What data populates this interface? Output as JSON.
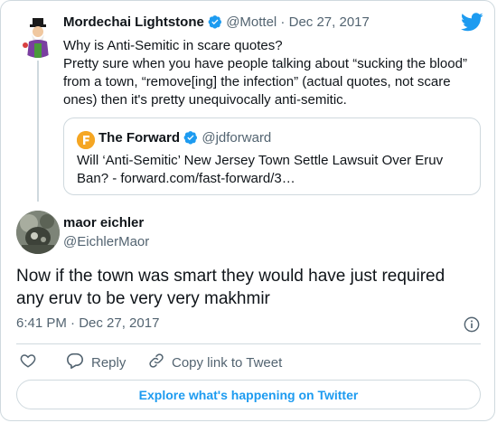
{
  "parent_tweet": {
    "author_name": "Mordechai Lightstone",
    "handle": "@Mottel",
    "date_sep": " · ",
    "date": "Dec 27, 2017",
    "text_lines": [
      "Why is Anti-Semitic in scare quotes?",
      "Pretty sure when you have people talking about “sucking the blood”",
      "from a town, “remove[ing] the infection” (actual quotes, not scare",
      "ones) then it's pretty unequivocally anti-semitic."
    ]
  },
  "quoted_tweet": {
    "author_name": "The Forward",
    "handle": "@jdforward",
    "text_lines": [
      "Will ‘Anti-Semitic’ New Jersey Town Settle Lawsuit Over Eruv",
      "Ban? - forward.com/fast-forward/3…"
    ]
  },
  "main_tweet": {
    "author_name": "maor eichler",
    "handle": "@EichlerMaor",
    "text_lines": [
      "Now if the town was smart they would have just required",
      "any eruv to be very very makhmir"
    ],
    "timestamp": "6:41 PM · Dec 27, 2017"
  },
  "actions": {
    "reply_label": "Reply",
    "copy_label": "Copy link to Tweet"
  },
  "explore_label": "Explore what's happening on Twitter",
  "icons": {
    "verified": "verified-badge-icon",
    "brand": "twitter-bird-icon",
    "info": "info-icon",
    "like": "heart-icon",
    "reply": "speech-bubble-icon",
    "copy": "link-icon"
  },
  "colors": {
    "brand_blue": "#1d9bf0",
    "text": "#0f1419",
    "muted": "#536471",
    "border": "#cfd9de",
    "forward_orange": "#f5a623"
  }
}
